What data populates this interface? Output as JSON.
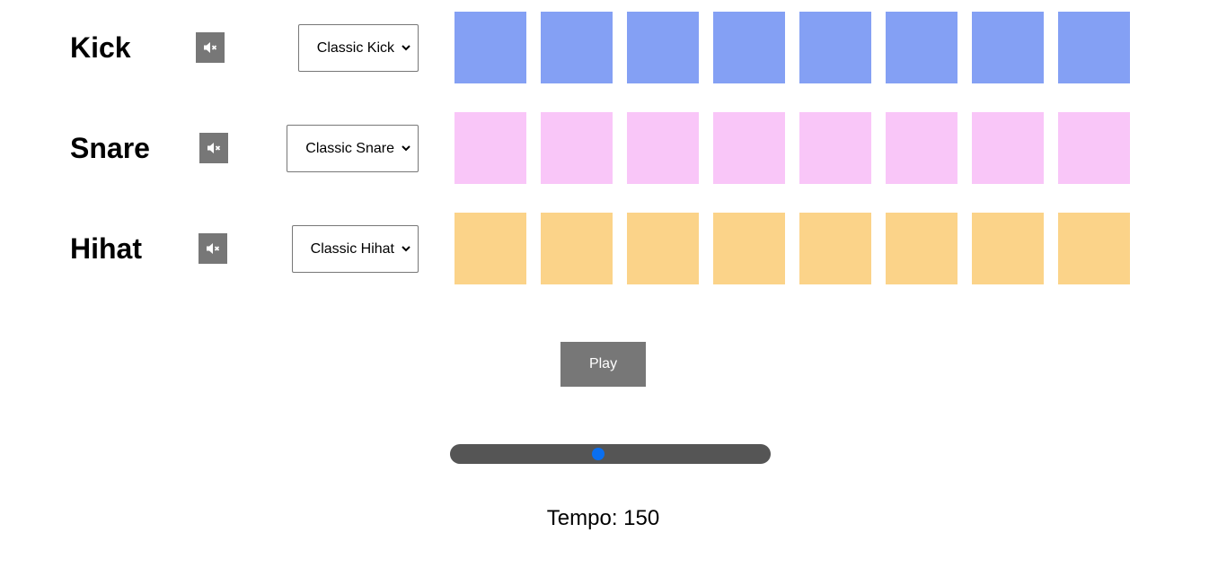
{
  "tracks": [
    {
      "name": "Kick",
      "sound": "Classic Kick",
      "pad_color": "#84a0f4",
      "mute_icon": "volume-mute-icon"
    },
    {
      "name": "Snare",
      "sound": "Classic Snare",
      "pad_color": "#f9c6f8",
      "mute_icon": "volume-mute-icon"
    },
    {
      "name": "Hihat",
      "sound": "Classic Hihat",
      "pad_color": "#fbd389",
      "mute_icon": "volume-mute-icon"
    }
  ],
  "controls": {
    "play_label": "Play",
    "tempo_label": "Tempo: ",
    "tempo_value": "150",
    "slider_fraction": 0.46
  },
  "colors": {
    "button_bg": "#777777",
    "slider_track": "#555555",
    "slider_thumb": "#0a6ff0"
  }
}
